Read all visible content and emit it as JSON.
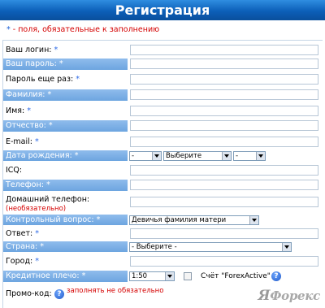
{
  "header": {
    "title": "Регистрация"
  },
  "note": {
    "star": "*",
    "text": " - поля, обязательные к заполнению"
  },
  "fields": {
    "login": {
      "label": "Ваш логин:",
      "req": " *"
    },
    "password": {
      "label": "Ваш пароль:",
      "req": " *"
    },
    "password2": {
      "label": "Пароль еще раз:",
      "req": " *"
    },
    "lastname": {
      "label": "Фамилия:",
      "req": " *"
    },
    "firstname": {
      "label": "Имя:",
      "req": " *"
    },
    "middlename": {
      "label": "Отчество:",
      "req": " *"
    },
    "email": {
      "label": "E-mail:",
      "req": " *"
    },
    "birthdate": {
      "label": "Дата рождения:",
      "req": " *",
      "day": "-",
      "month": "Выберите",
      "year": "-"
    },
    "icq": {
      "label": "ICQ:"
    },
    "phone": {
      "label": "Телефон:",
      "req": " *"
    },
    "homephone": {
      "label": "Домашний телефон:",
      "sub": "(необязательно)"
    },
    "question": {
      "label": "Контрольный вопрос:",
      "req": " *",
      "value": "Девичья фамилия матери"
    },
    "answer": {
      "label": "Ответ:",
      "req": " *"
    },
    "country": {
      "label": "Страна:",
      "req": " *",
      "value": "- Выберите -"
    },
    "city": {
      "label": "Город:",
      "req": " *"
    },
    "leverage": {
      "label": "Кредитное плечо:",
      "req": " *",
      "value": "1:50",
      "account_label": "Счёт \"ForexActive\""
    },
    "promo": {
      "label": "Промо-код:",
      "note": "заполнять не обязательно"
    }
  },
  "icons": {
    "help": "?"
  },
  "logo": {
    "ya": "Я",
    "rest": "Форекс"
  }
}
